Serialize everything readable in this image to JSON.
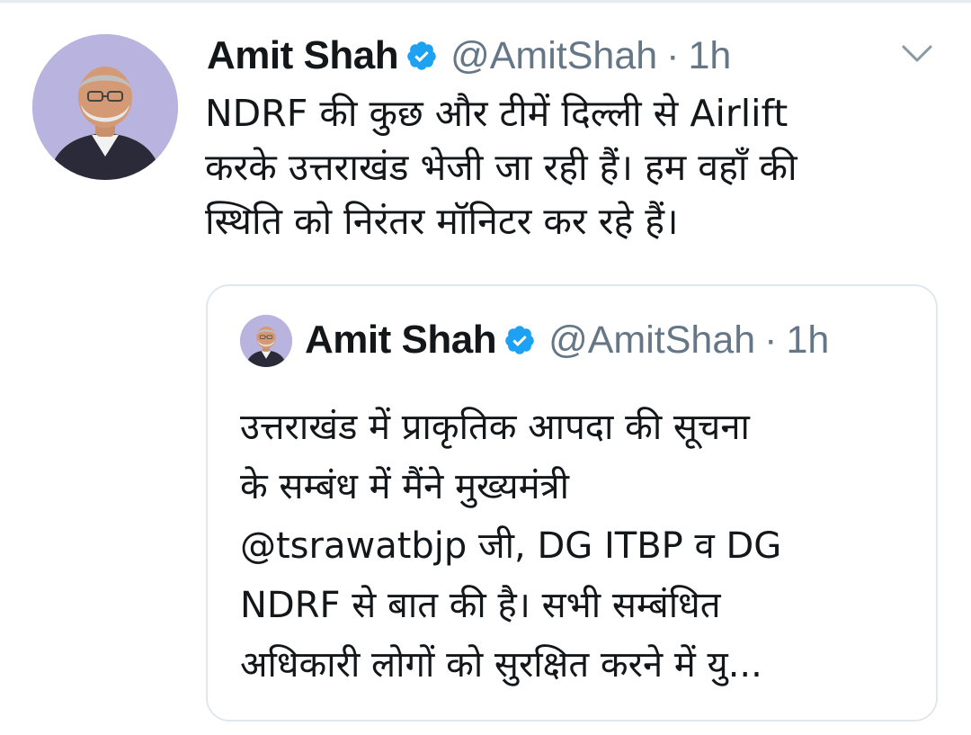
{
  "tweet": {
    "author_name": "Amit Shah",
    "handle": "@AmitShah",
    "separator": "·",
    "time": "1h",
    "verified": true,
    "text_lines": [
      "NDRF की कुछ और टीमें दिल्ली से Airlift",
      "करके उत्तराखंड भेजी जा रही हैं। हम वहाँ की",
      "स्थिति को निरंतर मॉनिटर कर रहे हैं।"
    ]
  },
  "quoted_tweet": {
    "author_name": "Amit Shah",
    "handle": "@AmitShah",
    "separator": "·",
    "time": "1h",
    "verified": true,
    "text_lines": [
      "उत्तराखंड में प्राकृतिक आपदा की सूचना",
      "के सम्बंध में मैंने मुख्यमंत्री",
      "@tsrawatbjp जी, DG ITBP व DG",
      "NDRF से बात की है। सभी सम्बंधित",
      "अधिकारी लोगों को सुरक्षित करने में यु..."
    ]
  },
  "colors": {
    "verified_badge": "#1da1f2",
    "secondary_text": "#657786",
    "primary_text": "#14171a",
    "quote_border": "#e1e8ed",
    "avatar_background": "#b9b4df"
  },
  "icons": {
    "verified": "verified-badge-icon",
    "caret": "chevron-down-icon"
  }
}
